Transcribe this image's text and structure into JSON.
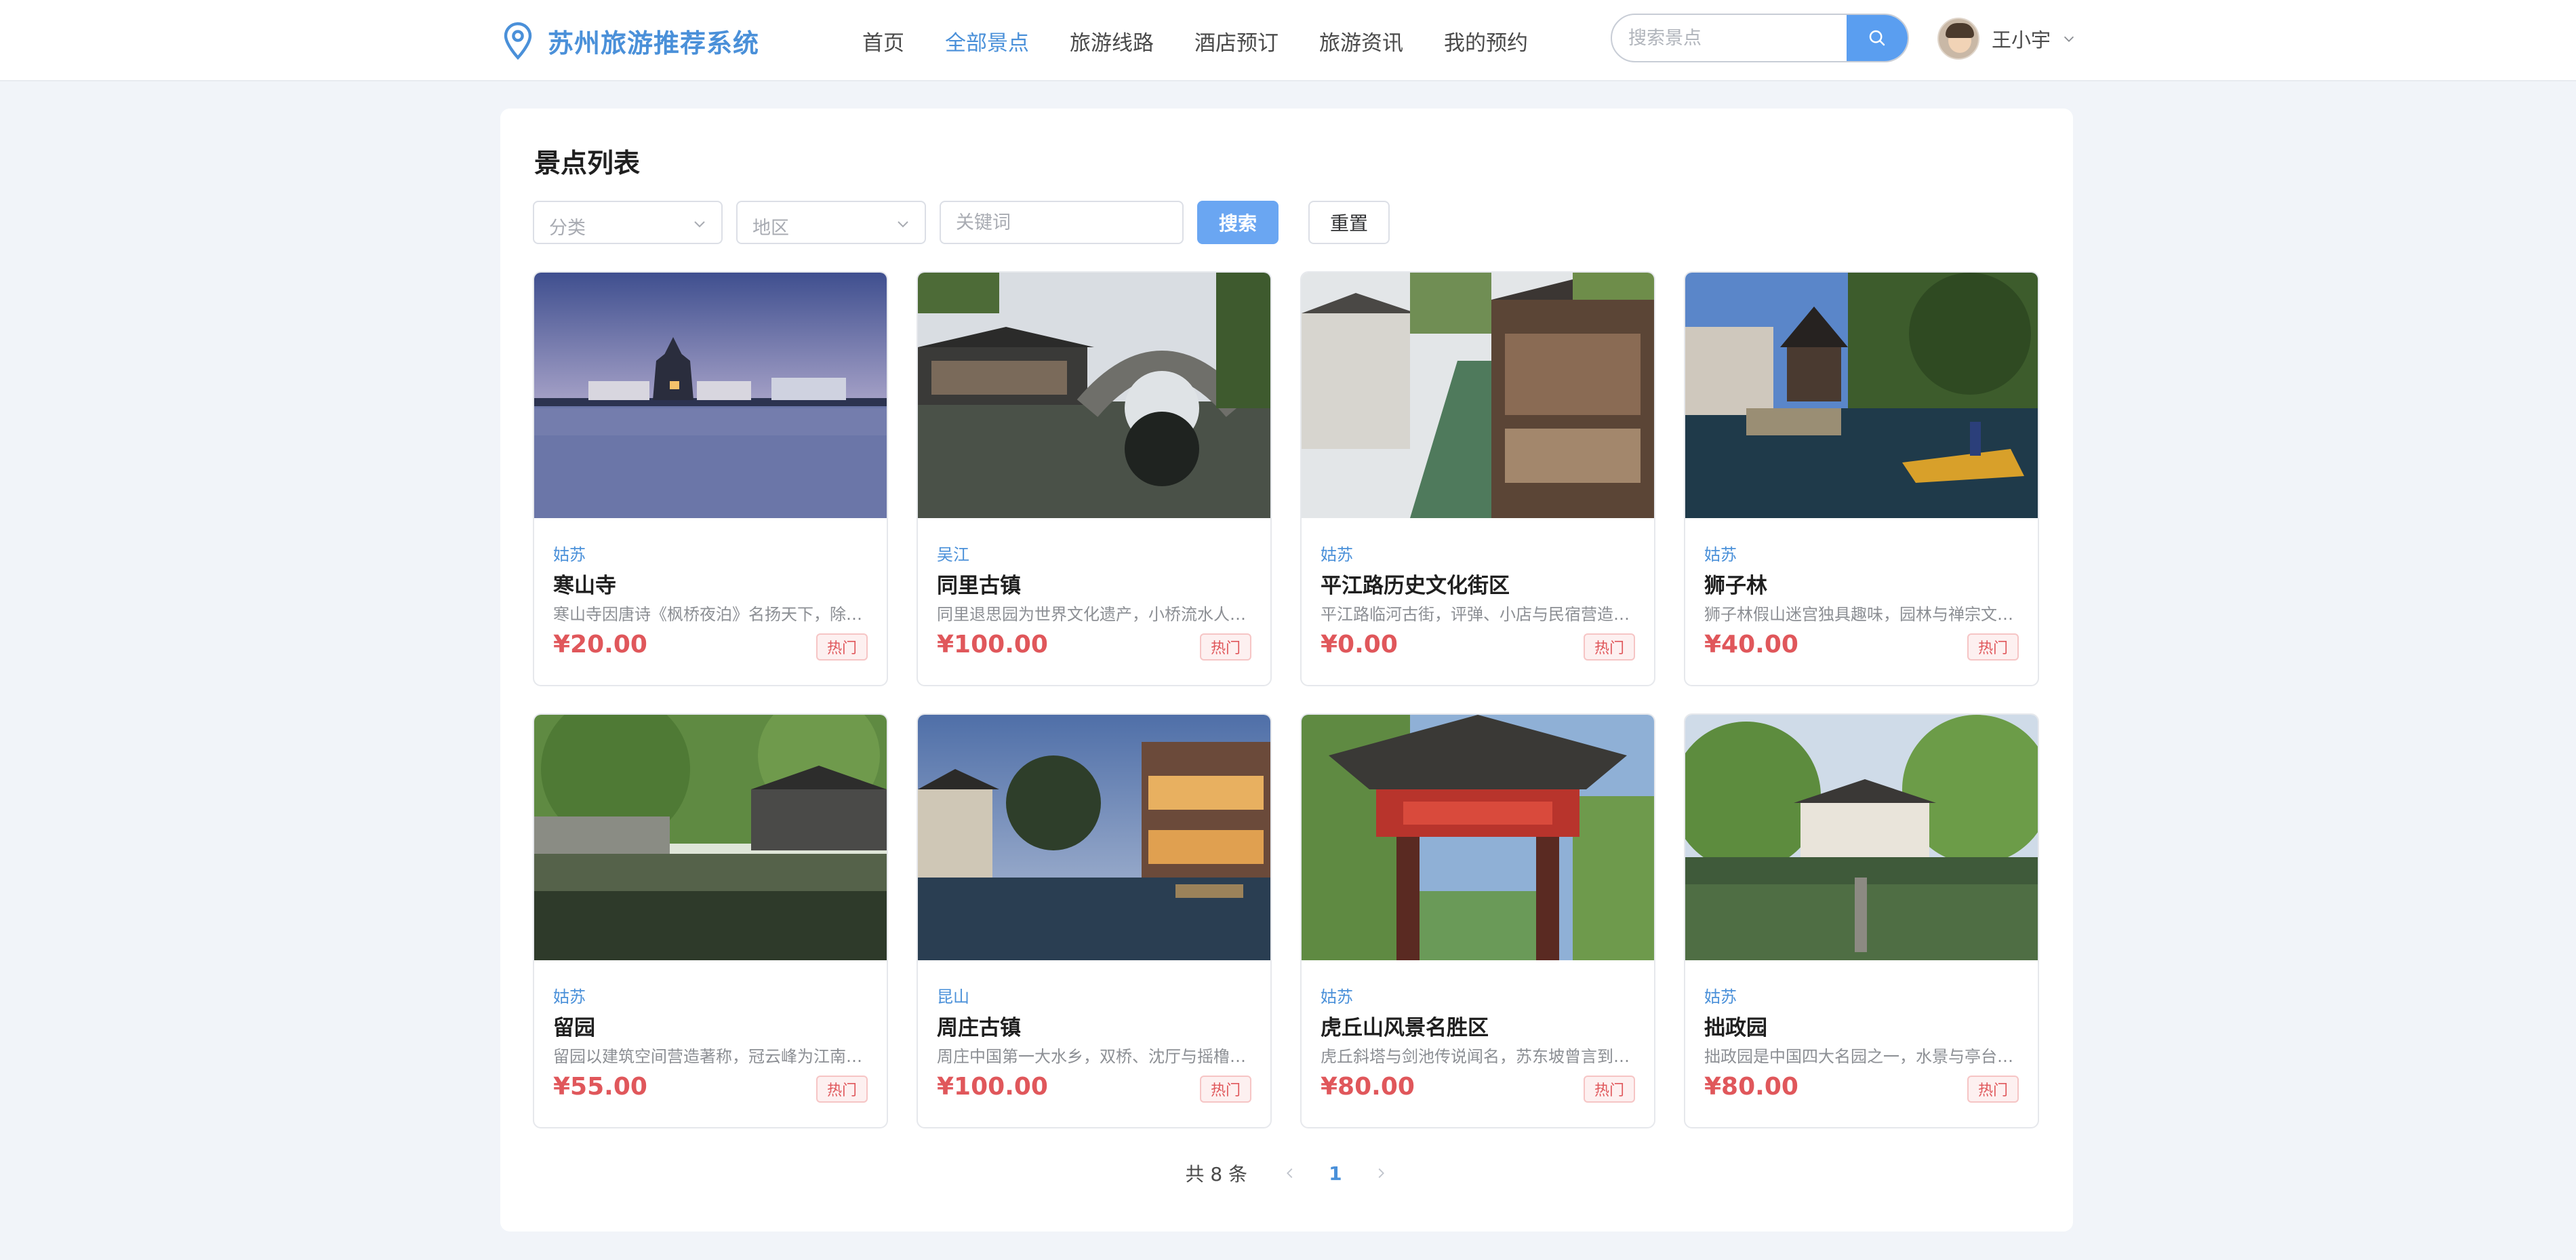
{
  "header": {
    "title": "苏州旅游推荐系统",
    "nav": [
      {
        "label": "首页",
        "active": false
      },
      {
        "label": "全部景点",
        "active": true
      },
      {
        "label": "旅游线路",
        "active": false
      },
      {
        "label": "酒店预订",
        "active": false
      },
      {
        "label": "旅游资讯",
        "active": false
      },
      {
        "label": "我的预约",
        "active": false
      }
    ],
    "search_placeholder": "搜索景点",
    "user_name": "王小宇",
    "accent_color": "#4a90d9"
  },
  "main": {
    "title": "景点列表",
    "filters": {
      "category_placeholder": "分类",
      "region_placeholder": "地区",
      "keyword_placeholder": "关键词",
      "search_label": "搜索",
      "reset_label": "重置"
    },
    "attractions": [
      {
        "region": "姑苏",
        "name": "寒山寺",
        "desc": "寒山寺因唐诗《枫桥夜泊》名扬天下，除…",
        "price": "¥20.00",
        "tag": "热门",
        "image": "temple-lake-dusk"
      },
      {
        "region": "吴江",
        "name": "同里古镇",
        "desc": "同里退思园为世界文化遗产，小桥流水人…",
        "price": "¥100.00",
        "tag": "热门",
        "image": "arched-bridge-canal"
      },
      {
        "region": "姑苏",
        "name": "平江路历史文化街区",
        "desc": "平江路临河古街，评弹、小店与民宿营造…",
        "price": "¥0.00",
        "tag": "热门",
        "image": "canal-street"
      },
      {
        "region": "姑苏",
        "name": "狮子林",
        "desc": "狮子林假山迷宫独具趣味，园林与禅宗文…",
        "price": "¥40.00",
        "tag": "热门",
        "image": "pavilion-boat"
      },
      {
        "region": "姑苏",
        "name": "留园",
        "desc": "留园以建筑空间营造著称，冠云峰为江南…",
        "price": "¥55.00",
        "tag": "热门",
        "image": "garden-pond"
      },
      {
        "region": "昆山",
        "name": "周庄古镇",
        "desc": "周庄中国第一大水乡，双桥、沈厅与摇橹…",
        "price": "¥100.00",
        "tag": "热门",
        "image": "water-town-night"
      },
      {
        "region": "姑苏",
        "name": "虎丘山风景名胜区",
        "desc": "虎丘斜塔与剑池传说闻名，苏东坡曾言到…",
        "price": "¥80.00",
        "tag": "热门",
        "image": "red-gate"
      },
      {
        "region": "姑苏",
        "name": "拙政园",
        "desc": "拙政园是中国四大名园之一，水景与亭台…",
        "price": "¥80.00",
        "tag": "热门",
        "image": "pavilion-pond"
      }
    ]
  },
  "pagination": {
    "total_label": "共 8 条",
    "current_page": "1"
  }
}
